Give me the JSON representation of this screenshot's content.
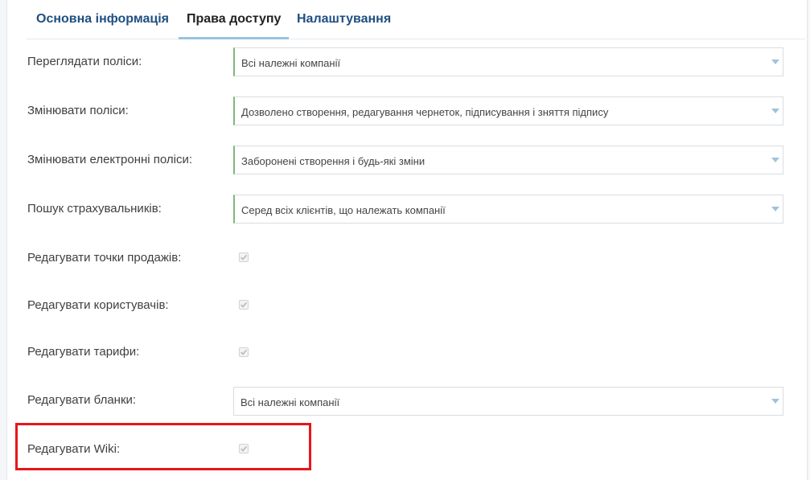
{
  "tabs": [
    {
      "label": "Основна інформація",
      "active": false
    },
    {
      "label": "Права доступу",
      "active": true
    },
    {
      "label": "Налаштування",
      "active": false
    }
  ],
  "permissions": {
    "view_policies": {
      "label": "Переглядати поліси:",
      "value": "Всі належні компанії"
    },
    "edit_policies": {
      "label": "Змінювати поліси:",
      "value": "Дозволено створення, редагування чернеток, підписування і зняття підпису"
    },
    "edit_e_policies": {
      "label": "Змінювати електронні поліси:",
      "value": "Заборонені створення і будь-які зміни"
    },
    "search_insurers": {
      "label": "Пошук страхувальників:",
      "value": "Серед всіх клієнтів, що належать компанії"
    },
    "edit_points_of_sale": {
      "label": "Редагувати точки продажів:",
      "checked": true
    },
    "edit_users": {
      "label": "Редагувати користувачів:",
      "checked": true
    },
    "edit_tariffs": {
      "label": "Редагувати тарифи:",
      "checked": true
    },
    "edit_forms": {
      "label": "Редагувати бланки:",
      "value": "Всі належні компанії"
    },
    "edit_wiki": {
      "label": "Редагувати Wiki:",
      "checked": true
    }
  },
  "colors": {
    "tab_text": "#1f4f82",
    "tab_active_underline": "#9bc4df",
    "highlight_border": "#e8151b",
    "valid_border": "#7fb77e",
    "caret": "#9dc3de"
  },
  "icons": {
    "select_caret": "chevron-down-icon",
    "checkbox_mark": "checkmark-icon"
  }
}
